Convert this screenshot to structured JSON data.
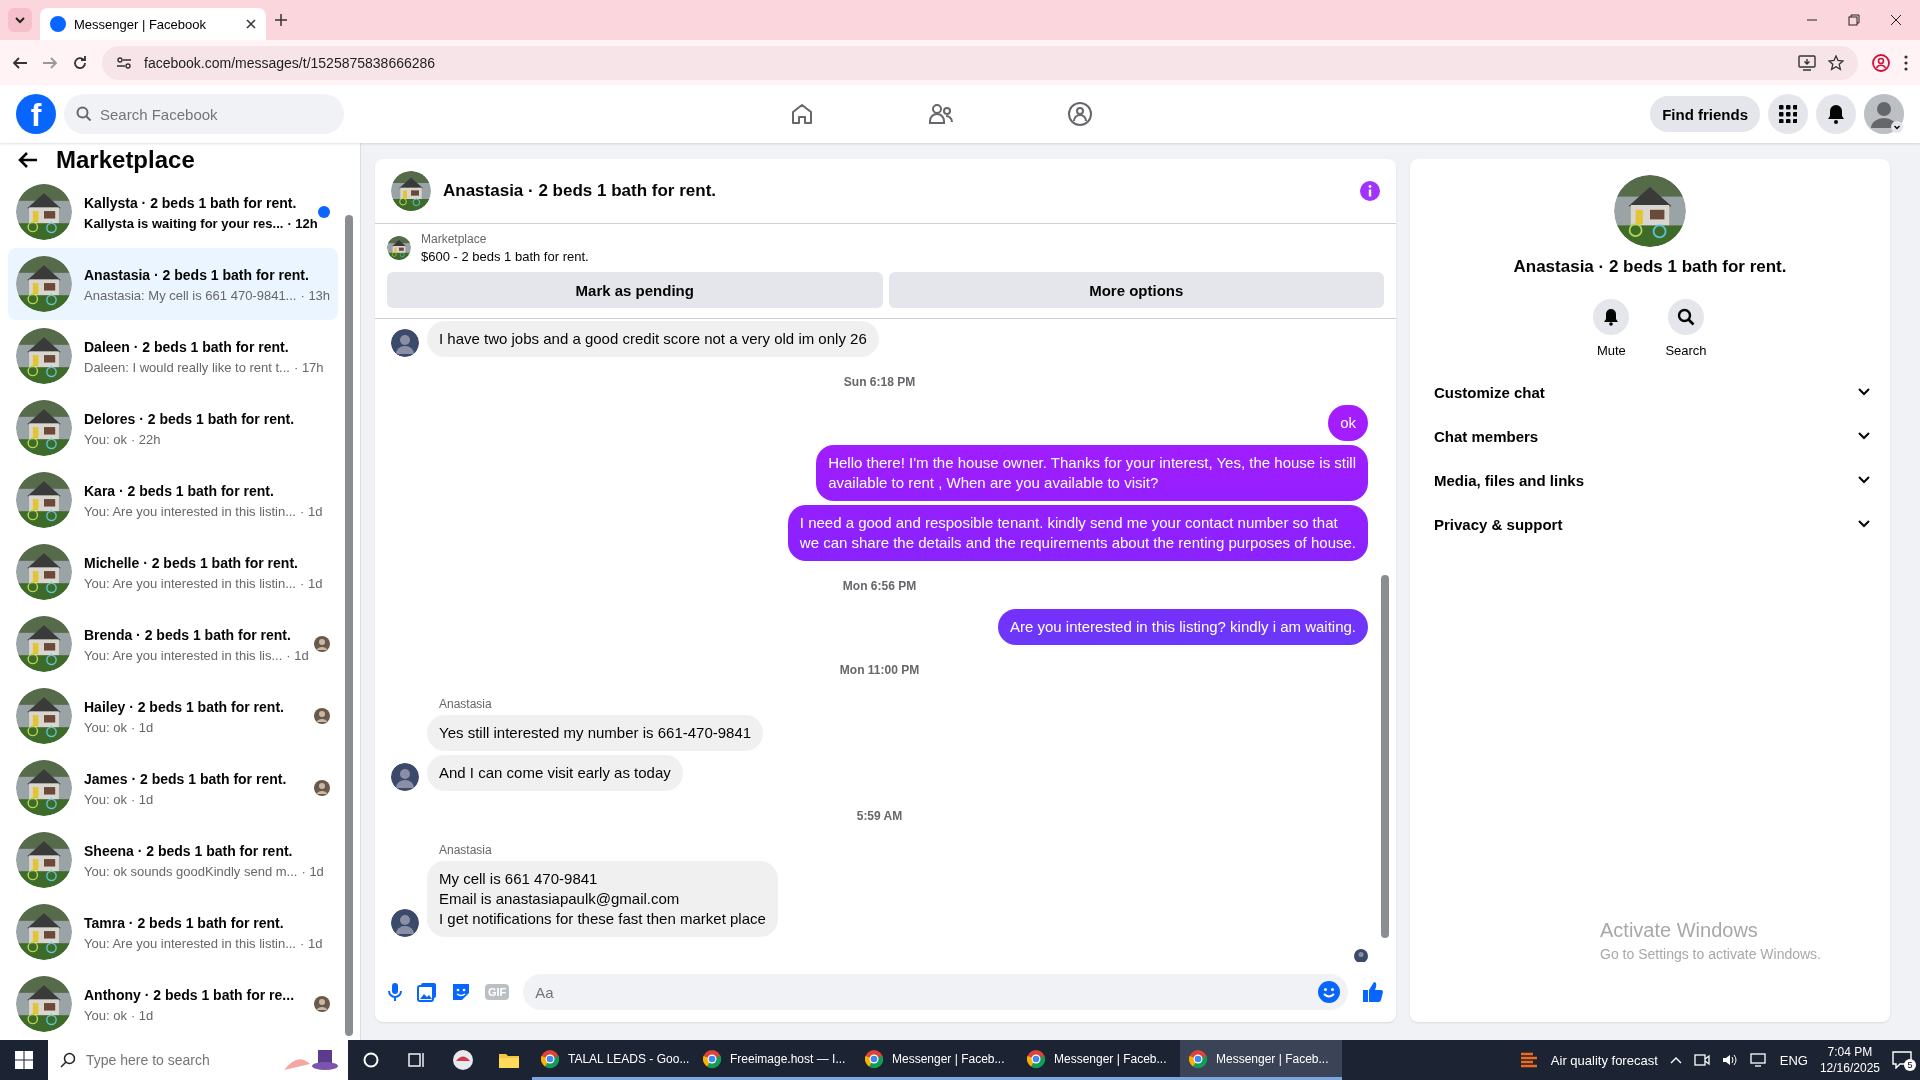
{
  "browser": {
    "tab_title": "Messenger | Facebook",
    "url": "facebook.com/messages/t/1525875838666286"
  },
  "header": {
    "logo": "f",
    "search_placeholder": "Search Facebook",
    "find_friends": "Find friends"
  },
  "sidebar": {
    "title": "Marketplace",
    "conversations": [
      {
        "title": "Kallysta · 2 beds 1 bath for rent.",
        "preview": "Kallysta is waiting for your res...",
        "time": "· 12h",
        "unread": true,
        "seen": false,
        "selected": false
      },
      {
        "title": "Anastasia · 2 beds 1 bath for rent.",
        "preview": "Anastasia: My cell is 661 470-9841...",
        "time": "· 13h",
        "unread": false,
        "seen": false,
        "selected": true
      },
      {
        "title": "Daleen · 2 beds 1 bath for rent.",
        "preview": "Daleen: I would really like to rent t...",
        "time": "· 17h",
        "unread": false,
        "seen": false,
        "selected": false
      },
      {
        "title": "Delores · 2 beds 1 bath for rent.",
        "preview": "You: ok",
        "time": "· 22h",
        "unread": false,
        "seen": false,
        "selected": false
      },
      {
        "title": "Kara · 2 beds 1 bath for rent.",
        "preview": "You: Are you interested in this listin...",
        "time": "· 1d",
        "unread": false,
        "seen": false,
        "selected": false
      },
      {
        "title": "Michelle · 2 beds 1 bath for rent.",
        "preview": "You: Are you interested in this listin...",
        "time": "· 1d",
        "unread": false,
        "seen": false,
        "selected": false
      },
      {
        "title": "Brenda · 2 beds 1 bath for rent.",
        "preview": "You: Are you interested in this lis...",
        "time": "· 1d",
        "unread": false,
        "seen": true,
        "selected": false
      },
      {
        "title": "Hailey · 2 beds 1 bath for rent.",
        "preview": "You: ok",
        "time": "· 1d",
        "unread": false,
        "seen": true,
        "selected": false
      },
      {
        "title": "James · 2 beds 1 bath for rent.",
        "preview": "You: ok",
        "time": "· 1d",
        "unread": false,
        "seen": true,
        "selected": false
      },
      {
        "title": "Sheena · 2 beds 1 bath for rent.",
        "preview": "You: ok sounds goodKindly send m...",
        "time": "· 1d",
        "unread": false,
        "seen": false,
        "selected": false
      },
      {
        "title": "Tamra · 2 beds 1 bath for rent.",
        "preview": "You: Are you interested in this listin...",
        "time": "· 1d",
        "unread": false,
        "seen": false,
        "selected": false
      },
      {
        "title": "Anthony · 2 beds 1 bath for re...",
        "preview": "You: ok",
        "time": "· 1d",
        "unread": false,
        "seen": true,
        "selected": false
      }
    ]
  },
  "chat": {
    "title": "Anastasia · 2 beds 1 bath for rent.",
    "listing": {
      "label": "Marketplace",
      "text": "$600 - 2 beds 1 bath for rent."
    },
    "buttons": [
      "Mark as pending",
      "More options"
    ],
    "messages": [
      {
        "kind": "incoming",
        "text": "I have two jobs and a good credit score not a very old im only 26",
        "avatar": true
      },
      {
        "kind": "timestamp",
        "text": "Sun 6:18 PM"
      },
      {
        "kind": "outgoing",
        "text": "ok"
      },
      {
        "kind": "outgoing",
        "text": "Hello there! I'm the house owner. Thanks for your interest, Yes, the house is still\navailable to rent , When are you available to visit?"
      },
      {
        "kind": "outgoing",
        "text": "I need a good and resposible tenant.  kindly send me your contact number so that\nwe can share the details and the requirements about the renting purposes of house."
      },
      {
        "kind": "timestamp",
        "text": "Mon 6:56 PM"
      },
      {
        "kind": "outgoing",
        "text": "Are you interested in this listing? kindly i am waiting."
      },
      {
        "kind": "timestamp",
        "text": "Mon 11:00 PM"
      },
      {
        "kind": "sender",
        "text": "Anastasia"
      },
      {
        "kind": "incoming",
        "text": "Yes still interested my number is 661-470-9841",
        "avatar": false
      },
      {
        "kind": "incoming",
        "text": "And I can come visit early as today",
        "avatar": true
      },
      {
        "kind": "timestamp",
        "text": "5:59 AM"
      },
      {
        "kind": "sender",
        "text": "Anastasia"
      },
      {
        "kind": "incoming",
        "text": "My cell is 661 470-9841\nEmail is anastasiapaulk@gmail.com\nI get notifications for these fast then market place",
        "avatar": true
      }
    ],
    "gif_label": "GIF",
    "composer_placeholder": "Aa"
  },
  "details": {
    "title": "Anastasia · 2 beds 1 bath for rent.",
    "actions": [
      "Mute",
      "Search"
    ],
    "sections": [
      "Customize chat",
      "Chat members",
      "Media, files and links",
      "Privacy & support"
    ]
  },
  "os_notice": {
    "title": "Activate Windows",
    "text": "Go to Settings to activate Windows."
  },
  "taskbar": {
    "search_placeholder": "Type here to search",
    "apps": [
      {
        "label": "TALAL LEADS - Goo...",
        "selected": false
      },
      {
        "label": "Freeimage.host — I...",
        "selected": false
      },
      {
        "label": "Messenger | Faceb...",
        "selected": false
      },
      {
        "label": "Messenger | Faceb...",
        "selected": false
      },
      {
        "label": "Messenger | Faceb...",
        "selected": true
      }
    ],
    "weather": "Air quality forecast",
    "language": "ENG",
    "time": "7:04 PM",
    "date": "12/16/2025",
    "notifications": "5"
  }
}
